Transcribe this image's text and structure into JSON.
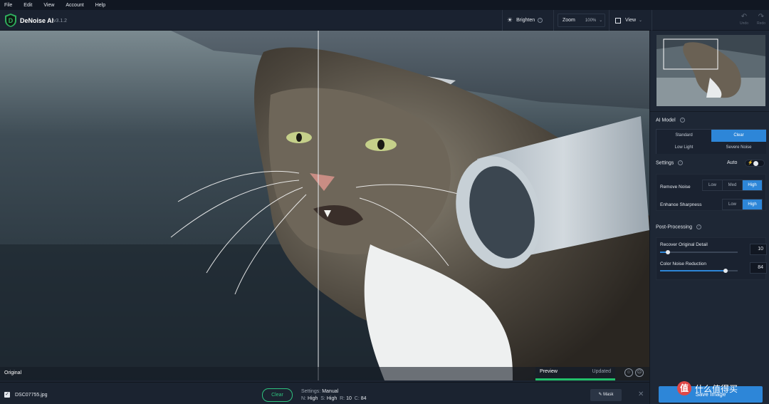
{
  "menu": [
    "File",
    "Edit",
    "View",
    "Account",
    "Help"
  ],
  "app": {
    "name": "DeNoise AI",
    "version": "v3.1.2"
  },
  "toolbar": {
    "brighten_label": "Brighten",
    "zoom_label": "Zoom",
    "zoom_value": "100%",
    "view_label": "View",
    "undo_label": "Undo",
    "redo_label": "Redo"
  },
  "canvas": {
    "original_label": "Original",
    "preview_label": "Preview",
    "updated_label": "Updated"
  },
  "bottom": {
    "filename": "DSC07755.jpg",
    "model_button": "Clear",
    "settings_label": "Settings:",
    "settings_value": "Manual",
    "n_label": "N:",
    "n_value": "High",
    "s_label": "S:",
    "s_value": "High",
    "r_label": "R:",
    "r_value": "10",
    "c_label": "C:",
    "c_value": "84",
    "mask_label": "Mask"
  },
  "panel": {
    "ai_model_title": "AI Model",
    "models": [
      {
        "label": "Standard",
        "active": false
      },
      {
        "label": "Clear",
        "active": true
      },
      {
        "label": "Low Light",
        "active": false
      },
      {
        "label": "Severe Noise",
        "active": false
      }
    ],
    "settings_title": "Settings",
    "auto_label": "Auto",
    "remove_noise": {
      "label": "Remove Noise",
      "options": [
        "Low",
        "Med",
        "High"
      ],
      "selected": "High"
    },
    "enhance_sharpness": {
      "label": "Enhance Sharpness",
      "options": [
        "Low",
        "High"
      ],
      "selected": "High"
    },
    "post_processing_title": "Post-Processing",
    "recover_detail": {
      "label": "Recover Original Detail",
      "value": "10",
      "fraction": 0.1
    },
    "color_noise": {
      "label": "Color Noise Reduction",
      "value": "84",
      "fraction": 0.84
    },
    "save_label": "Save Image"
  },
  "watermark": {
    "text": "值 什么值得买",
    "logo": "值"
  },
  "colors": {
    "accent": "#2d86d8",
    "green": "#2ec27e",
    "bg": "#1c2431"
  }
}
